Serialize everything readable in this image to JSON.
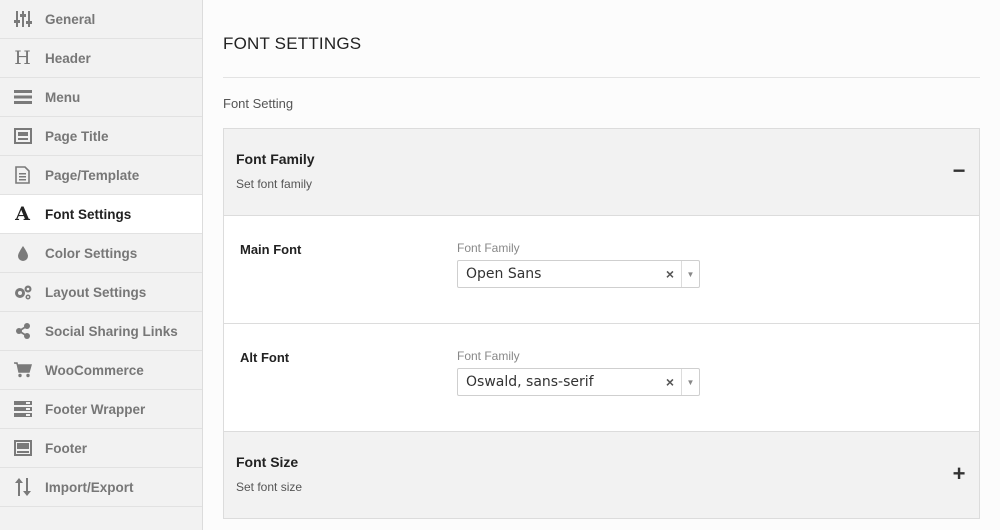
{
  "sidebar": {
    "items": [
      {
        "label": "General",
        "icon": "sliders-icon"
      },
      {
        "label": "Header",
        "icon": "heading-icon"
      },
      {
        "label": "Menu",
        "icon": "menu-icon"
      },
      {
        "label": "Page Title",
        "icon": "page-title-icon"
      },
      {
        "label": "Page/Template",
        "icon": "document-icon"
      },
      {
        "label": "Font Settings",
        "icon": "font-icon",
        "active": true
      },
      {
        "label": "Color Settings",
        "icon": "drop-icon"
      },
      {
        "label": "Layout Settings",
        "icon": "gears-icon"
      },
      {
        "label": "Social Sharing Links",
        "icon": "share-icon"
      },
      {
        "label": "WooCommerce",
        "icon": "cart-icon"
      },
      {
        "label": "Footer Wrapper",
        "icon": "footer-wrapper-icon"
      },
      {
        "label": "Footer",
        "icon": "footer-icon"
      },
      {
        "label": "Import/Export",
        "icon": "import-export-icon"
      }
    ]
  },
  "main": {
    "title": "FONT SETTINGS",
    "section_label": "Font Setting",
    "font_family_panel": {
      "title": "Font Family",
      "description": "Set font family",
      "toggle": "−",
      "expanded": true,
      "rows": [
        {
          "label": "Main Font",
          "field_label": "Font Family",
          "value": "Open Sans",
          "clear": "×",
          "arrow": "▼"
        },
        {
          "label": "Alt Font",
          "field_label": "Font Family",
          "value": "Oswald, sans-serif",
          "clear": "×",
          "arrow": "▼"
        }
      ]
    },
    "font_size_panel": {
      "title": "Font Size",
      "description": "Set font size",
      "toggle": "+",
      "expanded": false
    }
  }
}
